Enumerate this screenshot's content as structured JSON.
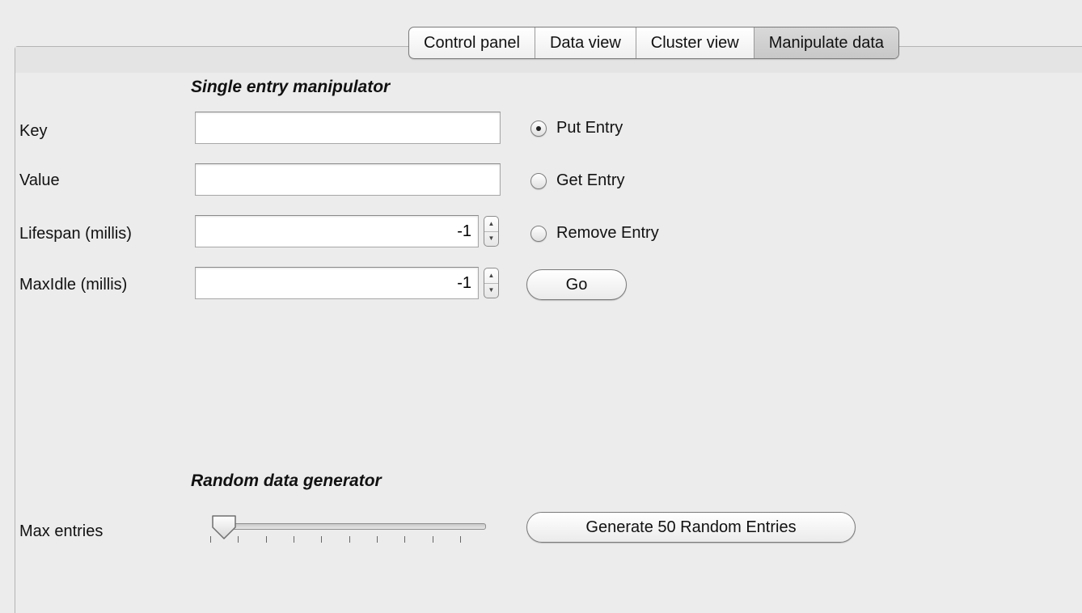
{
  "tabs": [
    {
      "label": "Control panel",
      "active": false
    },
    {
      "label": "Data view",
      "active": false
    },
    {
      "label": "Cluster view",
      "active": false
    },
    {
      "label": "Manipulate data",
      "active": true
    }
  ],
  "single_entry": {
    "title": "Single entry manipulator",
    "key": {
      "label": "Key",
      "value": ""
    },
    "value": {
      "label": "Value",
      "value": ""
    },
    "lifespan": {
      "label": "Lifespan (millis)",
      "value": "-1"
    },
    "maxidle": {
      "label": "MaxIdle (millis)",
      "value": "-1"
    },
    "operations": [
      {
        "label": "Put Entry",
        "selected": true
      },
      {
        "label": "Get Entry",
        "selected": false
      },
      {
        "label": "Remove Entry",
        "selected": false
      }
    ],
    "go_label": "Go"
  },
  "random_generator": {
    "title": "Random data generator",
    "max_entries_label": "Max entries",
    "slider_value_fraction": 0.0,
    "slider_tick_count": 10,
    "generate_label": "Generate 50 Random Entries"
  },
  "icons": {
    "spinner": "up-down-arrows-icon",
    "radio": "radio-button-icon",
    "slider_thumb": "slider-thumb-icon"
  }
}
